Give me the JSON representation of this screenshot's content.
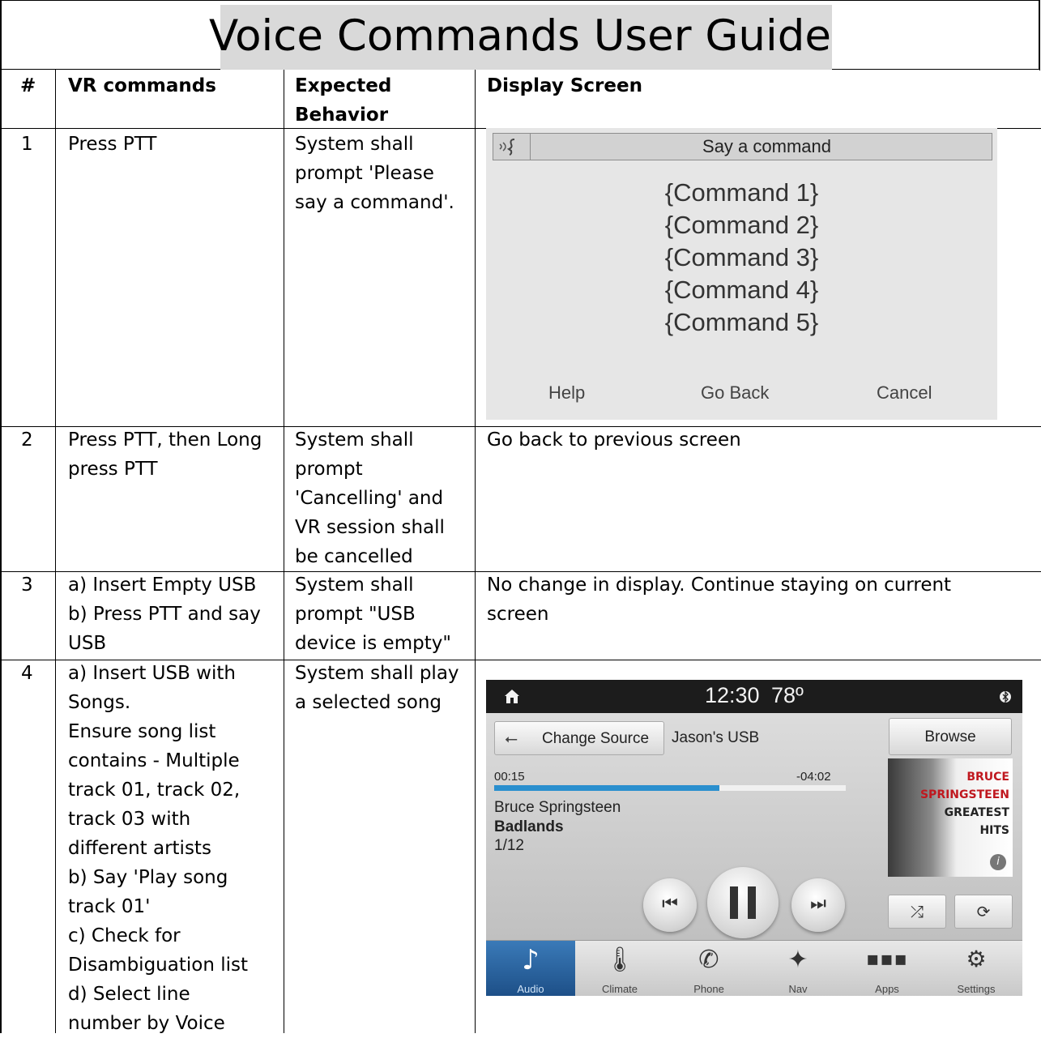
{
  "title": "Voice Commands User Guide",
  "headers": {
    "num": "#",
    "vr": "VR commands",
    "expected": "Expected Behavior",
    "display": "Display Screen"
  },
  "rows": [
    {
      "num": "1",
      "vr": [
        "Press PTT"
      ],
      "expected": [
        "System shall",
        "prompt 'Please",
        "say a command'."
      ]
    },
    {
      "num": "2",
      "vr": [
        "Press PTT, then Long",
        "press PTT"
      ],
      "expected": [
        "System shall",
        "prompt",
        "'Cancelling' and",
        "VR session shall",
        "be cancelled"
      ],
      "display": "Go back to previous screen"
    },
    {
      "num": "3",
      "vr": [
        "a) Insert Empty USB",
        "b) Press PTT and say",
        "USB"
      ],
      "expected": [
        "System shall",
        "prompt \"USB",
        "device is empty\""
      ],
      "display": [
        "No change in display. Continue staying on current",
        "screen"
      ]
    },
    {
      "num": "4",
      "vr": [
        "a) Insert USB with",
        "Songs.",
        "Ensure song list",
        "contains - Multiple",
        "track 01, track 02,",
        "track 03 with",
        "different artists",
        "b) Say 'Play song",
        "track 01'",
        "c) Check for",
        "Disambiguation list",
        "d) Select line",
        "number by Voice"
      ],
      "expected": [
        "System shall play",
        "a selected song"
      ]
    }
  ],
  "screen1": {
    "header": "Say a command",
    "icon": "voice-recognition-icon",
    "commands": [
      "{Command 1}",
      "{Command 2}",
      "{Command 3}",
      "{Command 4}",
      "{Command 5}"
    ],
    "footer": {
      "help": "Help",
      "back": "Go Back",
      "cancel": "Cancel"
    }
  },
  "screen4": {
    "clock": "12:30",
    "temp": "78º",
    "change_source": "Change Source",
    "source_name": "Jason's USB",
    "browse": "Browse",
    "elapsed": "00:15",
    "remaining": "-04:02",
    "progress": 0.64,
    "artist": "Bruce Springsteen",
    "track": "Badlands",
    "count": "1/12",
    "album_lines": [
      "BRUCE",
      "SPRINGSTEEN",
      "GREATEST",
      "HITS"
    ],
    "nav": [
      "Audio",
      "Climate",
      "Phone",
      "Nav",
      "Apps",
      "Settings"
    ],
    "accent": "#2a8fce"
  }
}
